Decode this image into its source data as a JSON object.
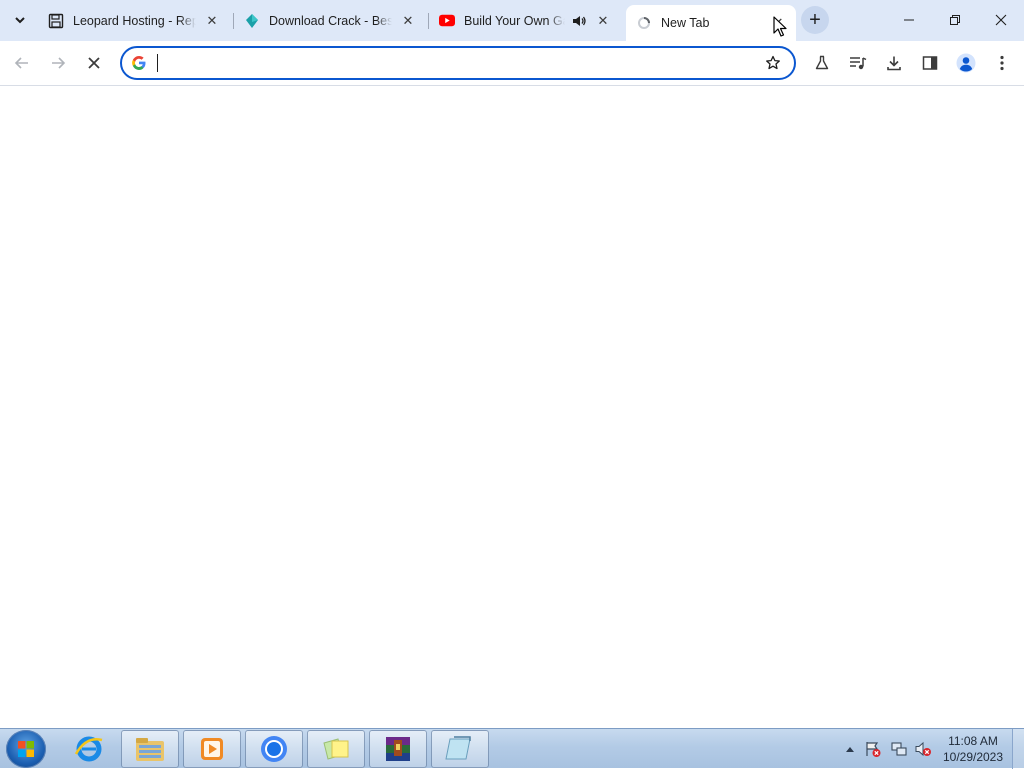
{
  "tabs": [
    {
      "title": "Leopard Hosting - Rep",
      "favicon": "floppy-disk-icon",
      "close": "✕"
    },
    {
      "title": "Download Crack - Best",
      "favicon": "teal-diamond-icon",
      "close": "✕"
    },
    {
      "title": "Build Your Own Ga",
      "favicon": "youtube-icon",
      "audio": "speaker-icon",
      "close": "✕"
    },
    {
      "title": "New Tab",
      "favicon": "loading-spinner-icon",
      "close": "✕",
      "active": true
    }
  ],
  "tab_search": {
    "icon": "chevron-down-icon"
  },
  "new_tab": {
    "label": "+"
  },
  "window_controls": {
    "minimize": "—",
    "restore": "❐",
    "close": "✕"
  },
  "toolbar": {
    "back_icon": "←",
    "forward_icon": "→",
    "stop_icon": "✕",
    "omnibox": {
      "value": "",
      "placeholder": "",
      "search_engine_icon": "google-g-icon"
    },
    "icons": [
      "labs-flask-icon",
      "media-controls-icon",
      "download-icon",
      "side-panel-icon",
      "profile-icon",
      "kebab-menu-icon"
    ]
  },
  "taskbar": {
    "apps": [
      "internet-explorer-icon",
      "file-explorer-icon",
      "media-player-icon",
      "chrome-icon",
      "sticky-notes-icon",
      "winrar-icon",
      "notepad-icon"
    ],
    "clock": {
      "time": "11:08 AM",
      "date": "10/29/2023"
    }
  },
  "colors": {
    "tabstrip": "#dee8f8",
    "omnibox_focus": "#0b57d0",
    "taskbar": "#b3cbe6"
  }
}
